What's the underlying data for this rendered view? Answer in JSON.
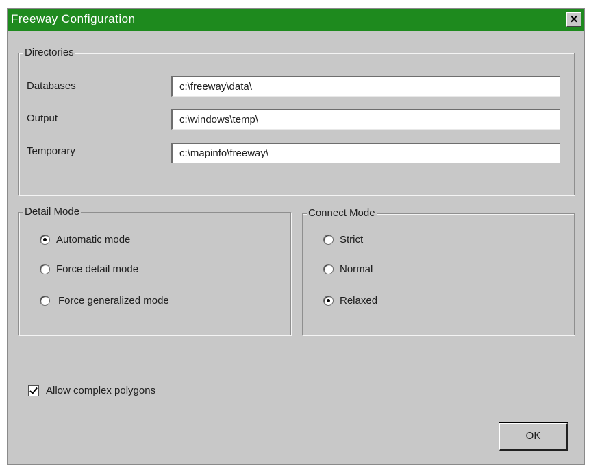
{
  "window": {
    "title": "Freeway Configuration",
    "close_label": "✕"
  },
  "directories": {
    "group_label": "Directories",
    "databases_label": "Databases",
    "databases_value": "c:\\freeway\\data\\",
    "output_label": "Output",
    "output_value": "c:\\windows\\temp\\",
    "temporary_label": "Temporary",
    "temporary_value": "c:\\mapinfo\\freeway\\"
  },
  "detail_mode": {
    "group_label": "Detail Mode",
    "options": [
      {
        "label": "Automatic mode",
        "checked": true
      },
      {
        "label": "Force detail mode",
        "checked": false
      },
      {
        "label": "Force generalized mode",
        "checked": false
      }
    ]
  },
  "connect_mode": {
    "group_label": "Connect Mode",
    "options": [
      {
        "label": "Strict",
        "checked": false
      },
      {
        "label": "Normal",
        "checked": false
      },
      {
        "label": "Relaxed",
        "checked": true
      }
    ]
  },
  "allow_complex_polygons": {
    "label": "Allow complex polygons",
    "checked": true
  },
  "ok_button": {
    "label": "OK"
  },
  "colors": {
    "titlebar": "#1e8a1e",
    "dialog_background": "#c8c8c8"
  }
}
